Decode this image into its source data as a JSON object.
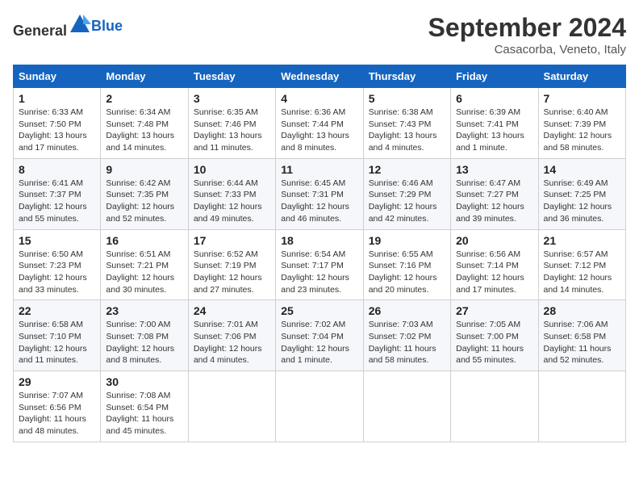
{
  "header": {
    "logo_general": "General",
    "logo_blue": "Blue",
    "month": "September 2024",
    "location": "Casacorba, Veneto, Italy"
  },
  "weekdays": [
    "Sunday",
    "Monday",
    "Tuesday",
    "Wednesday",
    "Thursday",
    "Friday",
    "Saturday"
  ],
  "weeks": [
    [
      {
        "day": "1",
        "sunrise": "Sunrise: 6:33 AM",
        "sunset": "Sunset: 7:50 PM",
        "daylight": "Daylight: 13 hours and 17 minutes."
      },
      {
        "day": "2",
        "sunrise": "Sunrise: 6:34 AM",
        "sunset": "Sunset: 7:48 PM",
        "daylight": "Daylight: 13 hours and 14 minutes."
      },
      {
        "day": "3",
        "sunrise": "Sunrise: 6:35 AM",
        "sunset": "Sunset: 7:46 PM",
        "daylight": "Daylight: 13 hours and 11 minutes."
      },
      {
        "day": "4",
        "sunrise": "Sunrise: 6:36 AM",
        "sunset": "Sunset: 7:44 PM",
        "daylight": "Daylight: 13 hours and 8 minutes."
      },
      {
        "day": "5",
        "sunrise": "Sunrise: 6:38 AM",
        "sunset": "Sunset: 7:43 PM",
        "daylight": "Daylight: 13 hours and 4 minutes."
      },
      {
        "day": "6",
        "sunrise": "Sunrise: 6:39 AM",
        "sunset": "Sunset: 7:41 PM",
        "daylight": "Daylight: 13 hours and 1 minute."
      },
      {
        "day": "7",
        "sunrise": "Sunrise: 6:40 AM",
        "sunset": "Sunset: 7:39 PM",
        "daylight": "Daylight: 12 hours and 58 minutes."
      }
    ],
    [
      {
        "day": "8",
        "sunrise": "Sunrise: 6:41 AM",
        "sunset": "Sunset: 7:37 PM",
        "daylight": "Daylight: 12 hours and 55 minutes."
      },
      {
        "day": "9",
        "sunrise": "Sunrise: 6:42 AM",
        "sunset": "Sunset: 7:35 PM",
        "daylight": "Daylight: 12 hours and 52 minutes."
      },
      {
        "day": "10",
        "sunrise": "Sunrise: 6:44 AM",
        "sunset": "Sunset: 7:33 PM",
        "daylight": "Daylight: 12 hours and 49 minutes."
      },
      {
        "day": "11",
        "sunrise": "Sunrise: 6:45 AM",
        "sunset": "Sunset: 7:31 PM",
        "daylight": "Daylight: 12 hours and 46 minutes."
      },
      {
        "day": "12",
        "sunrise": "Sunrise: 6:46 AM",
        "sunset": "Sunset: 7:29 PM",
        "daylight": "Daylight: 12 hours and 42 minutes."
      },
      {
        "day": "13",
        "sunrise": "Sunrise: 6:47 AM",
        "sunset": "Sunset: 7:27 PM",
        "daylight": "Daylight: 12 hours and 39 minutes."
      },
      {
        "day": "14",
        "sunrise": "Sunrise: 6:49 AM",
        "sunset": "Sunset: 7:25 PM",
        "daylight": "Daylight: 12 hours and 36 minutes."
      }
    ],
    [
      {
        "day": "15",
        "sunrise": "Sunrise: 6:50 AM",
        "sunset": "Sunset: 7:23 PM",
        "daylight": "Daylight: 12 hours and 33 minutes."
      },
      {
        "day": "16",
        "sunrise": "Sunrise: 6:51 AM",
        "sunset": "Sunset: 7:21 PM",
        "daylight": "Daylight: 12 hours and 30 minutes."
      },
      {
        "day": "17",
        "sunrise": "Sunrise: 6:52 AM",
        "sunset": "Sunset: 7:19 PM",
        "daylight": "Daylight: 12 hours and 27 minutes."
      },
      {
        "day": "18",
        "sunrise": "Sunrise: 6:54 AM",
        "sunset": "Sunset: 7:17 PM",
        "daylight": "Daylight: 12 hours and 23 minutes."
      },
      {
        "day": "19",
        "sunrise": "Sunrise: 6:55 AM",
        "sunset": "Sunset: 7:16 PM",
        "daylight": "Daylight: 12 hours and 20 minutes."
      },
      {
        "day": "20",
        "sunrise": "Sunrise: 6:56 AM",
        "sunset": "Sunset: 7:14 PM",
        "daylight": "Daylight: 12 hours and 17 minutes."
      },
      {
        "day": "21",
        "sunrise": "Sunrise: 6:57 AM",
        "sunset": "Sunset: 7:12 PM",
        "daylight": "Daylight: 12 hours and 14 minutes."
      }
    ],
    [
      {
        "day": "22",
        "sunrise": "Sunrise: 6:58 AM",
        "sunset": "Sunset: 7:10 PM",
        "daylight": "Daylight: 12 hours and 11 minutes."
      },
      {
        "day": "23",
        "sunrise": "Sunrise: 7:00 AM",
        "sunset": "Sunset: 7:08 PM",
        "daylight": "Daylight: 12 hours and 8 minutes."
      },
      {
        "day": "24",
        "sunrise": "Sunrise: 7:01 AM",
        "sunset": "Sunset: 7:06 PM",
        "daylight": "Daylight: 12 hours and 4 minutes."
      },
      {
        "day": "25",
        "sunrise": "Sunrise: 7:02 AM",
        "sunset": "Sunset: 7:04 PM",
        "daylight": "Daylight: 12 hours and 1 minute."
      },
      {
        "day": "26",
        "sunrise": "Sunrise: 7:03 AM",
        "sunset": "Sunset: 7:02 PM",
        "daylight": "Daylight: 11 hours and 58 minutes."
      },
      {
        "day": "27",
        "sunrise": "Sunrise: 7:05 AM",
        "sunset": "Sunset: 7:00 PM",
        "daylight": "Daylight: 11 hours and 55 minutes."
      },
      {
        "day": "28",
        "sunrise": "Sunrise: 7:06 AM",
        "sunset": "Sunset: 6:58 PM",
        "daylight": "Daylight: 11 hours and 52 minutes."
      }
    ],
    [
      {
        "day": "29",
        "sunrise": "Sunrise: 7:07 AM",
        "sunset": "Sunset: 6:56 PM",
        "daylight": "Daylight: 11 hours and 48 minutes."
      },
      {
        "day": "30",
        "sunrise": "Sunrise: 7:08 AM",
        "sunset": "Sunset: 6:54 PM",
        "daylight": "Daylight: 11 hours and 45 minutes."
      },
      null,
      null,
      null,
      null,
      null
    ]
  ]
}
